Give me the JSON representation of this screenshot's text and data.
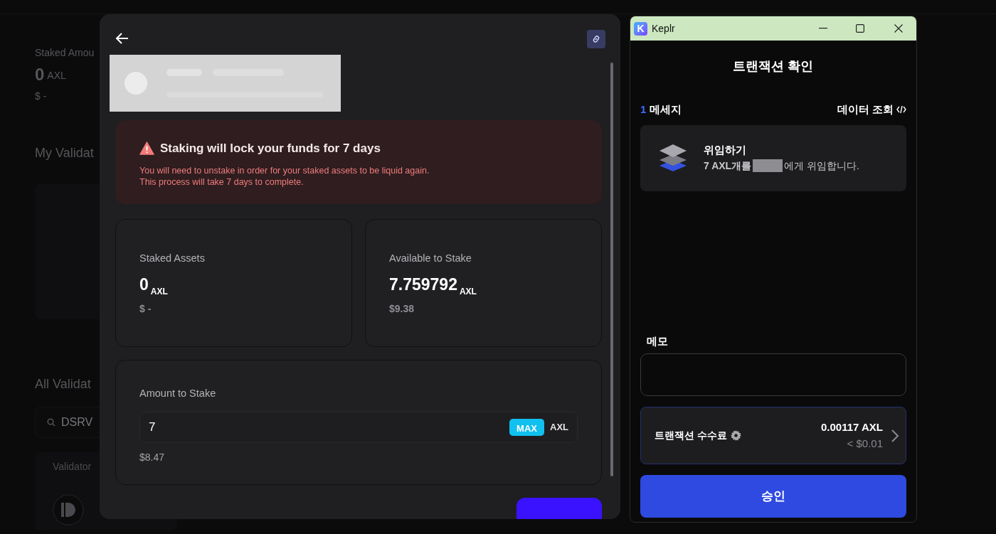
{
  "background_page": {
    "staked_label": "Staked Amou",
    "staked_value": "0",
    "staked_unit": "AXL",
    "staked_usd": "$ -",
    "my_validators_heading": "My Validat",
    "all_validators_heading": "All Validat",
    "search": {
      "value": "DSRV"
    },
    "table": {
      "columns": [
        "Validator"
      ]
    }
  },
  "modal": {
    "warning": {
      "title": "Staking will lock your funds for 7 days",
      "lines": [
        "You will need to unstake in order for your staked assets to be liquid again.",
        "This process will take 7 days to complete."
      ]
    },
    "stats": [
      {
        "label": "Staked Assets",
        "value": "0",
        "unit": "AXL",
        "usd": "$ -"
      },
      {
        "label": "Available to Stake",
        "value": "7.759792",
        "unit": "AXL",
        "usd": "$9.38"
      }
    ],
    "amount": {
      "label": "Amount to Stake",
      "value": "7",
      "max_button": "MAX",
      "unit": "AXL",
      "usd": "$8.47"
    }
  },
  "keplr": {
    "window": {
      "title": "Keplr",
      "logo_letter": "K"
    },
    "heading": "트랜잭션 확인",
    "message_count": "1",
    "message_label": "메세지",
    "view_data": "데이터 조회",
    "messages": [
      {
        "title": "위임하기",
        "text_before": "7 AXL개를",
        "text_after": "에게 위임합니다."
      }
    ],
    "memo": {
      "label": "메모"
    },
    "fee": {
      "label": "트랜잭션 수수료",
      "amount": "0.00117 AXL",
      "usd": "< $0.01"
    },
    "approve_button": "승인"
  }
}
